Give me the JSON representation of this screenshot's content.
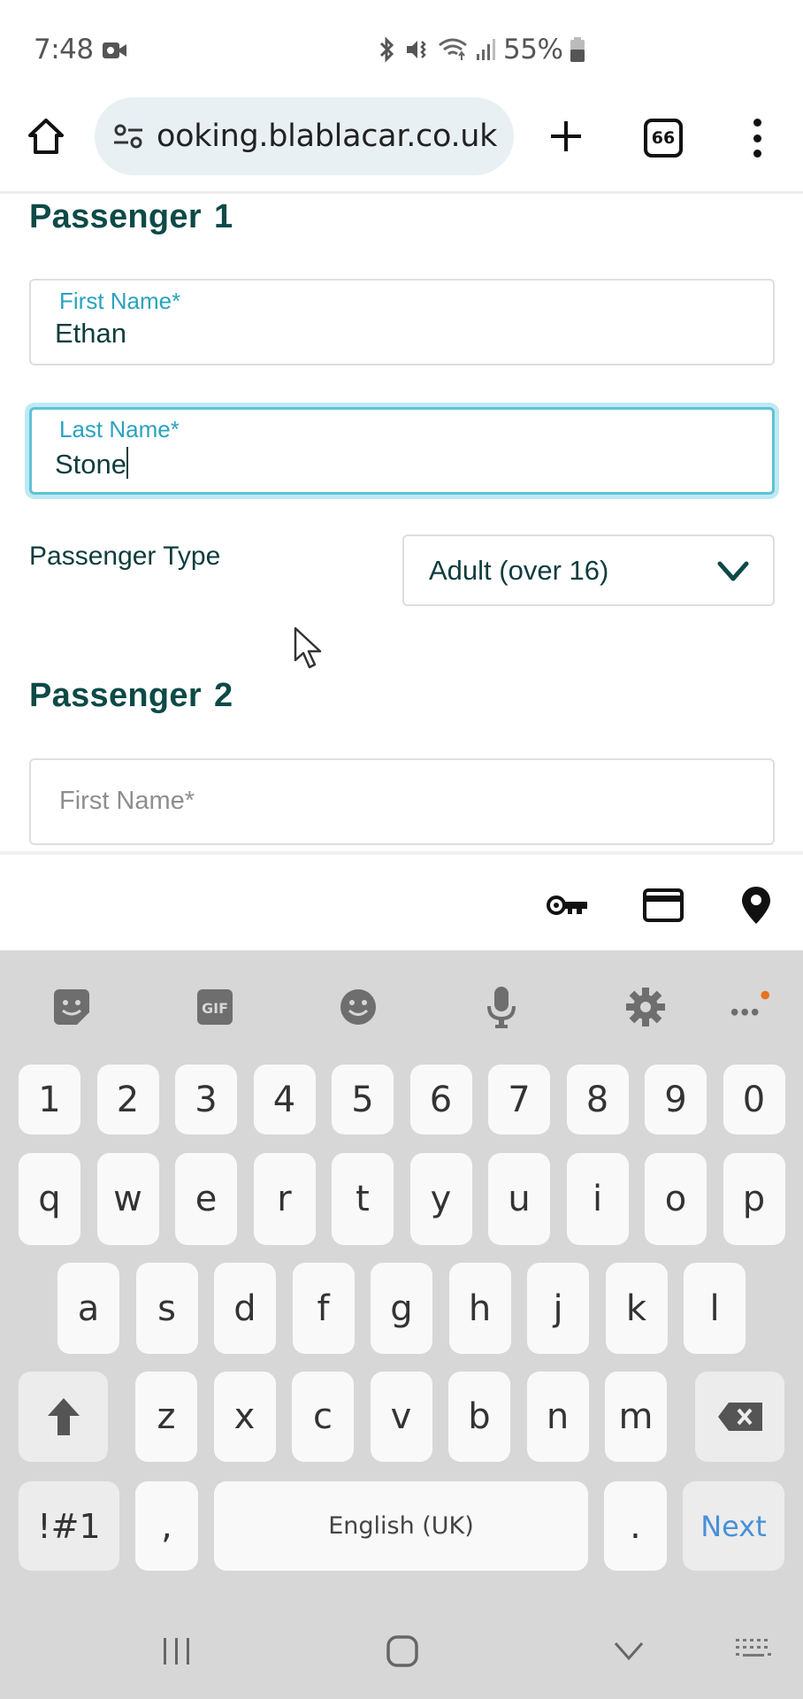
{
  "status_bar": {
    "time": "7:48",
    "battery_percent": "55%",
    "icons": [
      "video-camera-icon",
      "bluetooth-icon",
      "vibrate-mute-icon",
      "wifi-icon",
      "signal-icon",
      "battery-icon"
    ]
  },
  "browser": {
    "url": "ooking.blablacar.co.uk",
    "tab_count": "66",
    "icons": [
      "home-icon",
      "site-settings-icon",
      "plus-icon",
      "tabs-icon",
      "kebab-menu-icon"
    ]
  },
  "form": {
    "passenger1": {
      "heading_word": "Passenger",
      "heading_num": "1",
      "first_name_label": "First Name*",
      "first_name_value": "Ethan",
      "last_name_label": "Last Name*",
      "last_name_value": "Stone",
      "type_label": "Passenger Type",
      "type_value": "Adult (over 16)"
    },
    "passenger2": {
      "heading_word": "Passenger",
      "heading_num": "2",
      "first_name_placeholder": "First Name*"
    }
  },
  "autofill_bar": {
    "icons": [
      "key-icon",
      "credit-card-icon",
      "location-pin-icon"
    ]
  },
  "keyboard": {
    "toolbar": [
      "sticker-icon",
      "gif-icon",
      "emoji-icon",
      "microphone-icon",
      "settings-icon",
      "more-icon"
    ],
    "gif_label": "GIF",
    "row_numbers": [
      "1",
      "2",
      "3",
      "4",
      "5",
      "6",
      "7",
      "8",
      "9",
      "0"
    ],
    "row1": [
      "q",
      "w",
      "e",
      "r",
      "t",
      "y",
      "u",
      "i",
      "o",
      "p"
    ],
    "row2": [
      "a",
      "s",
      "d",
      "f",
      "g",
      "h",
      "j",
      "k",
      "l"
    ],
    "row3": [
      "z",
      "x",
      "c",
      "v",
      "b",
      "n",
      "m"
    ],
    "symbols_label": "!#1",
    "comma": ",",
    "space_label": "English (UK)",
    "period": ".",
    "next_label": "Next"
  },
  "navbar": {
    "icons": [
      "recent-apps-icon",
      "home-nav-icon",
      "hide-keyboard-icon",
      "keyboard-switch-icon"
    ]
  },
  "colors": {
    "heading": "#0d4a47",
    "label_accent": "#2aa3be",
    "focus_border": "#5ec2d6",
    "keyboard_bg": "#d7d7d7",
    "next_key": "#4a90d9",
    "notification_dot": "#e8731e"
  }
}
